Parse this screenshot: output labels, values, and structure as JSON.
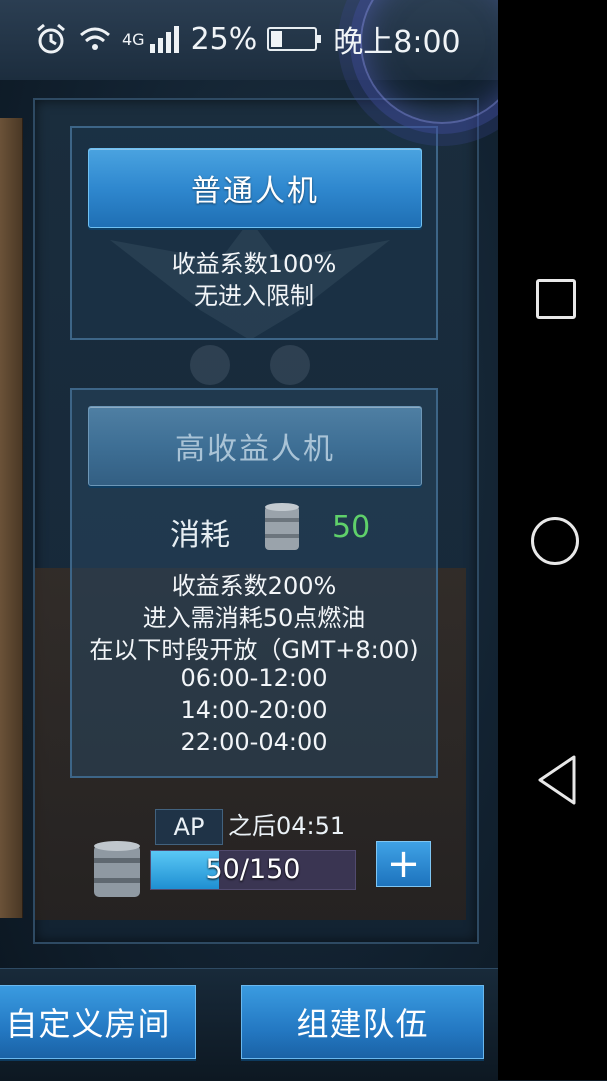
{
  "status_bar": {
    "signal_label": "4G",
    "battery_percent": "25%",
    "battery_level": 0.25,
    "time": "晚上8:00"
  },
  "normal_mode": {
    "button_label": "普通人机",
    "reward_line": "收益系数100%",
    "limit_line": "无进入限制"
  },
  "high_mode": {
    "button_label": "高收益人机",
    "consume_label": "消耗",
    "consume_value": "50",
    "lines": [
      "收益系数200%",
      "进入需消耗50点燃油",
      "在以下时段开放（GMT+8:00)",
      "06:00-12:00",
      "14:00-20:00",
      "22:00-04:00"
    ]
  },
  "ap": {
    "badge": "AP",
    "recover_text": "之后04:51",
    "progress_text": "50/150",
    "current": 50,
    "max": 150,
    "plus_label": "+"
  },
  "bottom": {
    "custom_room_label": "自定义房间",
    "team_label": "组建队伍"
  },
  "icons": {
    "alarm": "alarm-icon",
    "wifi": "wifi-icon",
    "signal": "signal-icon",
    "battery": "battery-icon",
    "anchor": "anchor-icon",
    "fuel": "fuel-barrel-icon",
    "nav_recent": "recent-apps-icon",
    "nav_home": "home-icon",
    "nav_back": "back-icon"
  },
  "colors": {
    "button_blue": "#2f88cf",
    "consume_value_green": "#5fd06a",
    "panel_border": "#3d6587"
  }
}
